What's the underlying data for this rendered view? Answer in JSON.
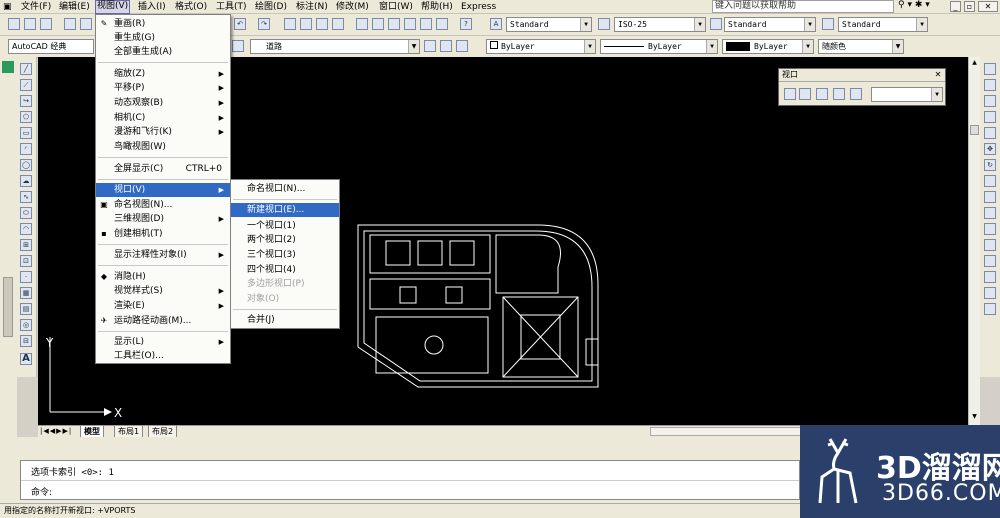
{
  "menubar": {
    "items": [
      "文件(F)",
      "编辑(E)",
      "视图(V)",
      "插入(I)",
      "格式(O)",
      "工具(T)",
      "绘图(D)",
      "标注(N)",
      "修改(M)",
      "窗口(W)",
      "帮助(H)",
      "Express"
    ],
    "help_placeholder": "键入问题以获取帮助"
  },
  "toolbar": {
    "text_style": "Standard",
    "dim_style": "ISO-25",
    "table_style": "Standard",
    "multileader_style": "Standard",
    "workspace": "AutoCAD 经典",
    "layer": "道路",
    "color": "ByLayer",
    "linetype": "ByLayer",
    "lineweight": "ByLayer",
    "plot_style": "随颜色"
  },
  "view_menu": {
    "items": [
      {
        "label": "重画(R)",
        "icon": "pencil-icon"
      },
      {
        "label": "重生成(G)"
      },
      {
        "label": "全部重生成(A)"
      },
      {
        "label": "缩放(Z)",
        "submenu": true
      },
      {
        "label": "平移(P)",
        "submenu": true
      },
      {
        "label": "动态观察(B)",
        "submenu": true
      },
      {
        "label": "相机(C)",
        "submenu": true
      },
      {
        "label": "漫游和飞行(K)",
        "submenu": true
      },
      {
        "label": "鸟瞰视图(W)"
      },
      {
        "label": "全屏显示(C)",
        "shortcut": "CTRL+0"
      },
      {
        "label": "视口(V)",
        "submenu": true,
        "highlighted": true
      },
      {
        "label": "命名视图(N)...",
        "icon": "named-view-icon"
      },
      {
        "label": "三维视图(D)",
        "submenu": true
      },
      {
        "label": "创建相机(T)",
        "icon": "camera-icon"
      },
      {
        "label": "显示注释性对象(I)",
        "submenu": true
      },
      {
        "label": "消隐(H)",
        "icon": "hide-icon"
      },
      {
        "label": "视觉样式(S)",
        "submenu": true
      },
      {
        "label": "渲染(E)",
        "submenu": true
      },
      {
        "label": "运动路径动画(M)...",
        "icon": "motion-path-icon"
      },
      {
        "label": "显示(L)",
        "submenu": true
      },
      {
        "label": "工具栏(O)..."
      }
    ]
  },
  "viewport_submenu": {
    "items": [
      {
        "label": "命名视口(N)..."
      },
      {
        "label": "新建视口(E)...",
        "highlighted": true
      },
      {
        "label": "一个视口(1)"
      },
      {
        "label": "两个视口(2)"
      },
      {
        "label": "三个视口(3)"
      },
      {
        "label": "四个视口(4)"
      },
      {
        "label": "多边形视口(P)",
        "disabled": true
      },
      {
        "label": "对象(O)",
        "disabled": true
      },
      {
        "label": "合并(J)"
      }
    ]
  },
  "viewport_toolbar": {
    "title": "视口"
  },
  "layout_tabs": [
    "模型",
    "布局1",
    "布局2"
  ],
  "ucs": {
    "x": "X",
    "y": "Y"
  },
  "command": {
    "history": "选项卡索引 <0>: 1",
    "prompt": "命令:"
  },
  "status": {
    "text": "用指定的名称打开新视口: +VPORTS"
  },
  "watermark": {
    "line1": "3D溜溜网",
    "line2": "3D66.COM"
  },
  "colors": {
    "canvas": "#000000",
    "menu_highlight": "#316ac5",
    "watermark_bg": "#2a3f6a"
  }
}
